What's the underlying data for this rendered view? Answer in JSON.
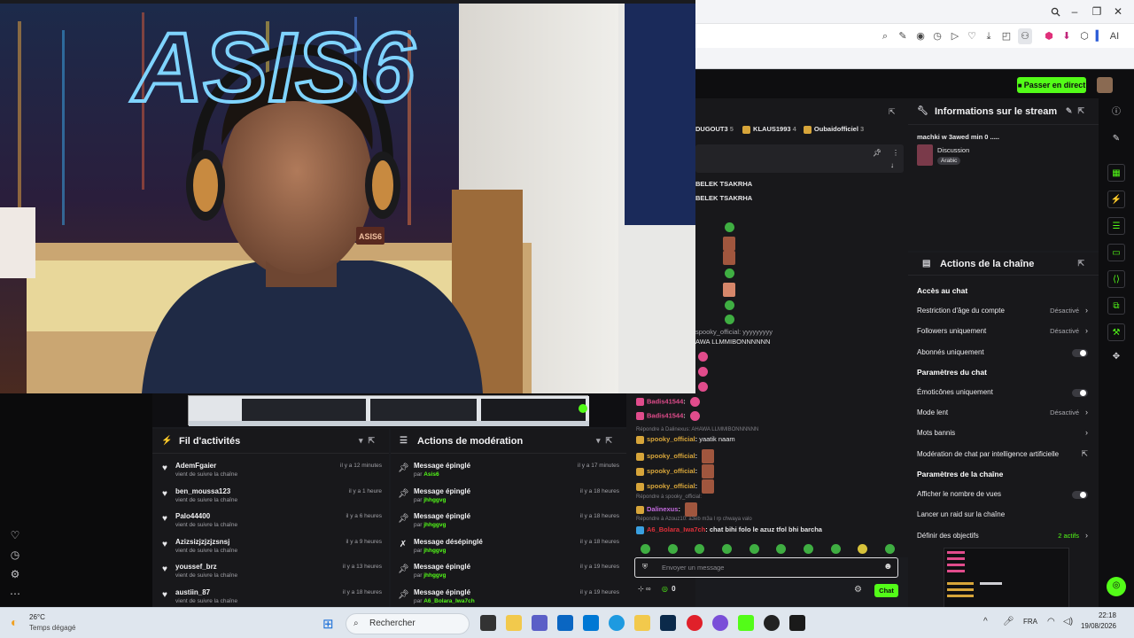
{
  "browser": {
    "toolbar_ai_label": "AI"
  },
  "app": {
    "go_live_label": "Passer en direct"
  },
  "stream_info": {
    "title": "Informations sur le stream",
    "stream_title": "machki w 3awed min 0 .....",
    "category": "Discussion",
    "language_tag": "Arabic"
  },
  "chat": {
    "top_users": [
      {
        "name": "DUGOUT3",
        "count": "5"
      },
      {
        "name": "KLAUS1993",
        "count": "4"
      },
      {
        "name": "Oubaidofficiel",
        "count": "3"
      }
    ],
    "lines": [
      {
        "user": "",
        "text": "BELEK TSAKRHA"
      },
      {
        "user": "",
        "text": "BELEK TSAKRHA"
      },
      {
        "user": "spooky_official",
        "text": "yyyyyyyyy"
      },
      {
        "user": "",
        "text": "AWA LLMMIBONNNNNN"
      },
      {
        "user": "Badis41544",
        "text": ""
      },
      {
        "user": "Badis41544",
        "text": ""
      },
      {
        "reply": "Répondre à Dalinexus: AHAWA LLMMIBONNNNNN"
      },
      {
        "user": "spooky_official",
        "text": "yaatik naam"
      },
      {
        "user": "spooky_official",
        "text": ""
      },
      {
        "user": "spooky_official",
        "text": ""
      },
      {
        "user": "spooky_official",
        "text": ""
      },
      {
        "reply": "Répondre à spooky_official:"
      },
      {
        "user": "Dalinexus",
        "text": ""
      },
      {
        "reply": "Répondre à Azouz10: a3eb m3a l rp chwaya valo"
      },
      {
        "user": "A6_Bolara_Iwa7ch",
        "text": "chat bihi folo le azuz tfol bhi barcha"
      }
    ],
    "input_placeholder": "Envoyer un message",
    "points_value": "0",
    "send_label": "Chat"
  },
  "activity_feed": {
    "title": "Fil d'activités",
    "items": [
      {
        "name": "AdemFgaier",
        "sub": "vient de suivre la chaîne",
        "time": "il y a 12 minutes"
      },
      {
        "name": "ben_moussa123",
        "sub": "vient de suivre la chaîne",
        "time": "il y a 1 heure"
      },
      {
        "name": "Palo44400",
        "sub": "vient de suivre la chaîne",
        "time": "il y a 6 heures"
      },
      {
        "name": "Azizsizjzjzjzsnsj",
        "sub": "vient de suivre la chaîne",
        "time": "il y a 9 heures"
      },
      {
        "name": "youssef_brz",
        "sub": "vient de suivre la chaîne",
        "time": "il y a 13 heures"
      },
      {
        "name": "austiin_87",
        "sub": "vient de suivre la chaîne",
        "time": "il y a 18 heures"
      }
    ]
  },
  "moderation": {
    "title": "Actions de modération",
    "items": [
      {
        "action": "Message épinglé",
        "by_prefix": "par",
        "by": "Asis6",
        "time": "il y a 17 minutes"
      },
      {
        "action": "Message épinglé",
        "by_prefix": "par",
        "by": "jhhggvg",
        "time": "il y a 18 heures"
      },
      {
        "action": "Message épinglé",
        "by_prefix": "par",
        "by": "jhhggvg",
        "time": "il y a 18 heures"
      },
      {
        "action": "Message désépinglé",
        "by_prefix": "par",
        "by": "jhhggvg",
        "time": "il y a 18 heures"
      },
      {
        "action": "Message épinglé",
        "by_prefix": "par",
        "by": "jhhggvg",
        "time": "il y a 19 heures"
      },
      {
        "action": "Message épinglé",
        "by_prefix": "par",
        "by": "A6_Bolara_Iwa7ch",
        "time": "il y a 19 heures"
      }
    ]
  },
  "channel_actions": {
    "title": "Actions de la chaîne",
    "chat_access_heading": "Accès au chat",
    "age_restriction": {
      "label": "Restriction d'âge du compte",
      "value": "Désactivé"
    },
    "followers_only": {
      "label": "Followers uniquement",
      "value": "Désactivé"
    },
    "subscribers_only": {
      "label": "Abonnés uniquement"
    },
    "chat_settings_heading": "Paramètres du chat",
    "emotes_only": {
      "label": "Émoticônes uniquement"
    },
    "slow_mode": {
      "label": "Mode lent",
      "value": "Désactivé"
    },
    "banned_words": {
      "label": "Mots bannis"
    },
    "ai_moderation": {
      "label": "Modération de chat par intelligence artificielle"
    },
    "channel_settings_heading": "Paramètres de la chaîne",
    "show_views": {
      "label": "Afficher le nombre de vues"
    },
    "raid": {
      "label": "Lancer un raid sur la chaîne"
    },
    "goals": {
      "label": "Définir des objectifs",
      "value": "2 actifs"
    }
  },
  "taskbar": {
    "weather_temp": "26°C",
    "weather_desc": "Temps dégagé",
    "search_label": "Rechercher",
    "lang": "FRA",
    "time": "22:18",
    "date": "19/08/2026"
  },
  "webcam": {
    "neon_text": "ASIS6",
    "bed_logo": "ASIS6"
  },
  "colors": {
    "accent": "#53fc18",
    "panel": "#18181b",
    "bg": "#0e0e10"
  }
}
